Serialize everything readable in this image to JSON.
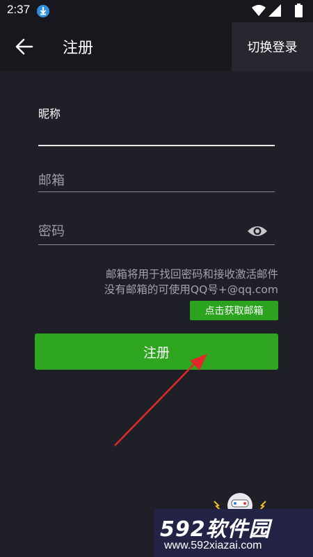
{
  "status_bar": {
    "time": "2:37"
  },
  "toolbar": {
    "title": "注册",
    "switch_login": "切换登录"
  },
  "form": {
    "nickname_label": "昵称",
    "email_placeholder": "邮箱",
    "password_placeholder": "密码",
    "hint_line1": "邮箱将用于找回密码和接收激活邮件",
    "hint_line2": "没有邮箱的可使用QQ号+@qq.com",
    "get_email_label": "点击获取邮箱",
    "register_label": "注册"
  },
  "watermark": {
    "logo": "592软件园",
    "url": "www.592xiazai.com"
  },
  "colors": {
    "accent_green": "#2ea61f",
    "arrow_red": "#e02a2a",
    "background": "#1f1f27"
  }
}
